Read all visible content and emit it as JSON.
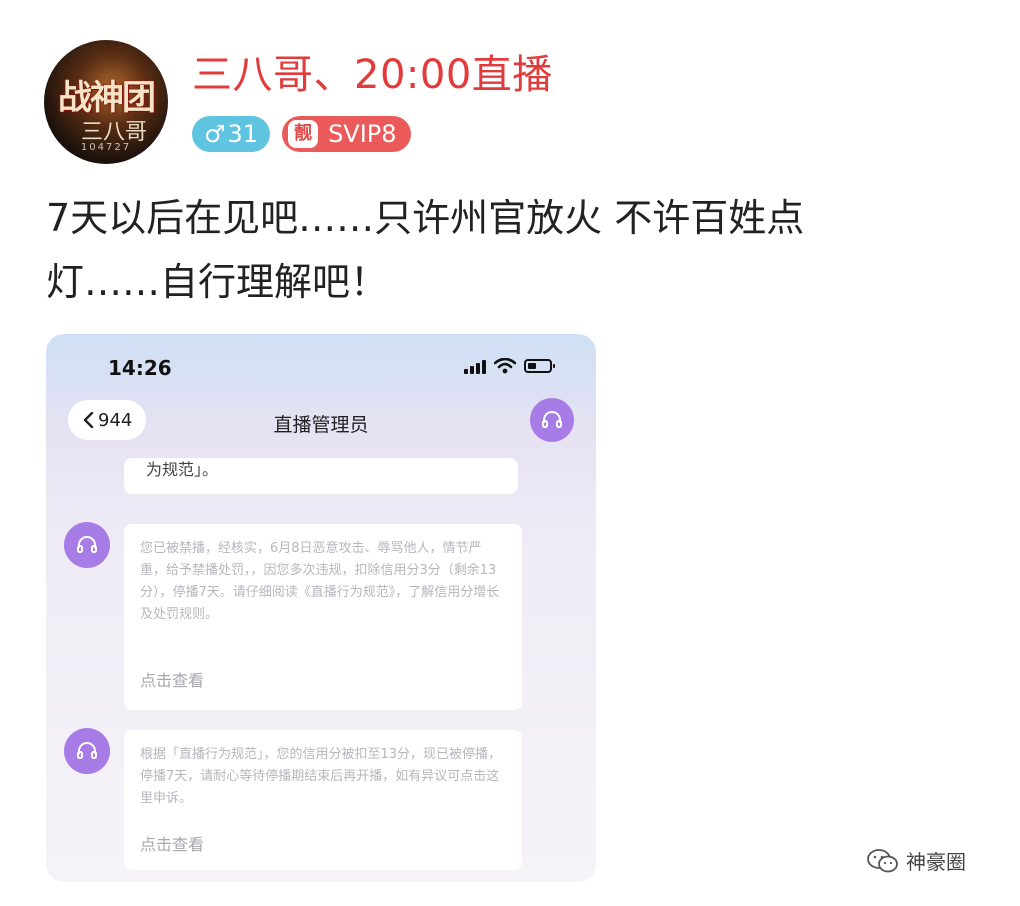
{
  "post": {
    "avatar": {
      "text_main": "战神团",
      "text_sub": "三八哥",
      "text_num": "104727"
    },
    "username": "三八哥、20:00直播",
    "gender_badge": {
      "symbol": "♂",
      "age": "31"
    },
    "vip_badge": {
      "icon_text": "靓",
      "label": "SVIP8"
    },
    "text_line1": "7天以后在见吧……只许州官放火 不许百姓点",
    "text_line2": "灯……自行理解吧！"
  },
  "screenshot": {
    "status_time": "14:26",
    "back_label": "944",
    "title": "直播管理员",
    "top_bubble_text": "为规范」。",
    "messages": [
      {
        "text": "您已被禁播，经核实，6月8日恶意攻击、辱骂他人，情节严重，给予禁播处罚，，因您多次违规，扣除信用分3分（剩余13分），停播7天。请仔细阅读《直播行为规范》，了解信用分增长及处罚规则。",
        "link": "点击查看"
      },
      {
        "text": "根据「直播行为规范」，您的信用分被扣至13分，现已被停播，停播7天，请耐心等待停播期结束后再开播，如有异议可点击这里申诉。",
        "link": "点击查看"
      }
    ]
  },
  "watermark": {
    "label": "神豪圈"
  },
  "colors": {
    "username": "#e23b3b",
    "gender_badge": "#5ec4df",
    "vip_badge": "#ea5a5a",
    "support_purple": "#a77ce6"
  }
}
